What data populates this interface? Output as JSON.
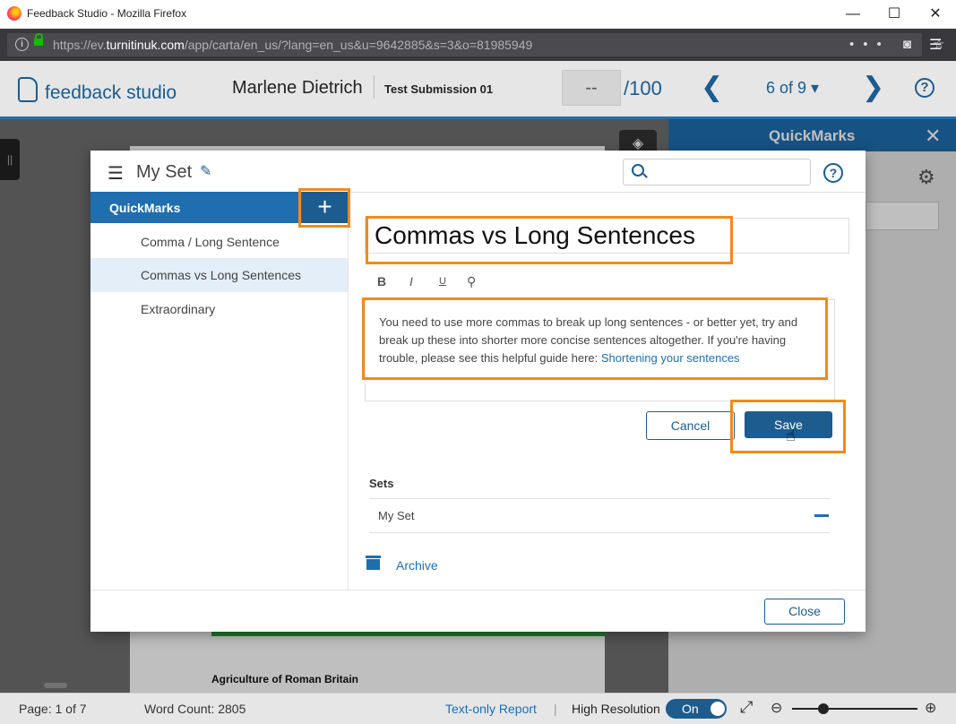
{
  "browser": {
    "window_title": "Feedback Studio - Mozilla Firefox",
    "url_prefix": "https://ev.",
    "url_domain": "turnitinuk.com",
    "url_rest": "/app/carta/en_us/?lang=en_us&u=9642885&s=3&o=81985949",
    "controls": {
      "minimize": "—",
      "maximize": "☐",
      "close": "✕"
    }
  },
  "header": {
    "brand": "feedback studio",
    "student_name": "Marlene Dietrich",
    "submission": "Test Submission 01",
    "grade": "--",
    "grade_max": "/100",
    "prev": "❮",
    "next": "❯",
    "paging": "6 of 9 ▾",
    "help": "?"
  },
  "document": {
    "title": "Agriculture of Roman Britain"
  },
  "right_panel": {
    "title": "QuickMarks",
    "close": "✕",
    "gear": "⚙"
  },
  "modal": {
    "set_title": "My Set",
    "search_placeholder": "",
    "help": "?",
    "sidebar": {
      "header": "QuickMarks",
      "add": "+",
      "items": [
        {
          "label": "Comma / Long Sentence"
        },
        {
          "label": "Commas vs Long Sentences"
        },
        {
          "label": "Extraordinary"
        }
      ]
    },
    "editor": {
      "title_value": "Commas vs Long Sentences",
      "format_bold": "B",
      "format_italic": "I",
      "format_underline": "U",
      "format_link": "⚲",
      "body_text": "You need to use more commas to break up long sentences - or better yet, try and break up these into shorter more concise sentences altogether. If you're having trouble, please see this helpful guide here: ",
      "body_link": "Shortening your sentences",
      "cancel": "Cancel",
      "save": "Save"
    },
    "sets": {
      "label": "Sets",
      "items": [
        {
          "name": "My Set"
        }
      ]
    },
    "archive": "Archive",
    "close": "Close"
  },
  "statusbar": {
    "page": "Page: 1 of 7",
    "word_count": "Word Count: 2805",
    "text_only": "Text-only Report",
    "divider": "|",
    "high_res": "High Resolution",
    "toggle": "On",
    "zoom_out": "⊖",
    "zoom_in": "⊕",
    "fullscreen": "⤢"
  },
  "colors": {
    "brand_blue": "#1c5c8f",
    "highlight_orange": "#f28a1c",
    "accent_blue": "#1e6eb0"
  }
}
